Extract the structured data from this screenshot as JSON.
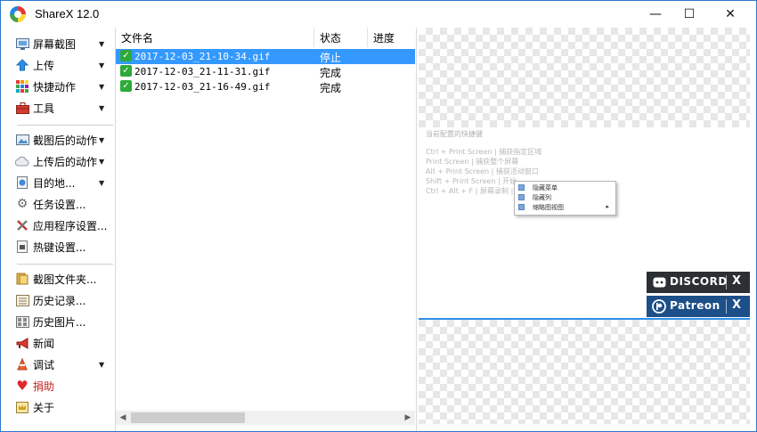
{
  "window": {
    "title": "ShareX 12.0",
    "minimize_glyph": "—",
    "maximize_glyph": "☐",
    "close_glyph": "✕"
  },
  "sidebar": {
    "items": [
      {
        "label": "屏幕截图",
        "icon": "screenshot-icon",
        "submenu": true
      },
      {
        "label": "上传",
        "icon": "upload-arrow-icon",
        "submenu": true
      },
      {
        "label": "快捷动作",
        "icon": "grid-icon",
        "submenu": true
      },
      {
        "label": "工具",
        "icon": "toolbox-icon",
        "submenu": true
      },
      {
        "label": "截图后的动作",
        "icon": "picture-icon",
        "submenu": true
      },
      {
        "label": "上传后的动作",
        "icon": "cloud-icon",
        "submenu": true
      },
      {
        "label": "目的地...",
        "icon": "globe-icon",
        "submenu": true
      },
      {
        "label": "任务设置...",
        "icon": "gear-icon",
        "submenu": false
      },
      {
        "label": "应用程序设置...",
        "icon": "wrench-icon",
        "submenu": false
      },
      {
        "label": "热键设置...",
        "icon": "keyboard-icon",
        "submenu": false
      },
      {
        "label": "截图文件夹...",
        "icon": "folder-icon",
        "submenu": false
      },
      {
        "label": "历史记录...",
        "icon": "history-list-icon",
        "submenu": false
      },
      {
        "label": "历史图片...",
        "icon": "image-history-icon",
        "submenu": false
      },
      {
        "label": "新闻",
        "icon": "megaphone-icon",
        "submenu": false
      },
      {
        "label": "调试",
        "icon": "traffic-cone-icon",
        "submenu": true
      },
      {
        "label": "捐助",
        "icon": "heart-icon",
        "submenu": false
      },
      {
        "label": "关于",
        "icon": "crown-icon",
        "submenu": false
      }
    ],
    "submenu_arrow": "▼"
  },
  "filelist": {
    "columns": [
      "文件名",
      "状态",
      "进度"
    ],
    "rows": [
      {
        "name": "2017-12-03_21-10-34.gif",
        "status": "停止",
        "selected": true
      },
      {
        "name": "2017-12-03_21-11-31.gif",
        "status": "完成",
        "selected": false
      },
      {
        "name": "2017-12-03_21-16-49.gif",
        "status": "完成",
        "selected": false
      }
    ],
    "check_glyph": "✓",
    "scroll_left": "◀",
    "scroll_right": "▶"
  },
  "preview": {
    "hotkey_title": "当前配置的快捷键",
    "hotkeys": [
      "Ctrl + Print Screen  |  捕获指定区域",
      "Print Screen  |  捕获整个屏幕",
      "Alt + Print Screen  |  捕获活动窗口",
      "Shift + Print Screen  |  开始",
      "Ctrl + Alt + F  |  屏幕录制  |"
    ],
    "context_menu": [
      {
        "label": "隐藏菜单",
        "arrow": ""
      },
      {
        "label": "隐藏列",
        "arrow": ""
      },
      {
        "label": "缩略图视图",
        "arrow": "▸"
      }
    ],
    "discord": {
      "label": "DISCORD",
      "close": "X",
      "color": "#2c2f33"
    },
    "patreon": {
      "label": "Patreon",
      "close": "X",
      "color": "#1d4f88"
    }
  },
  "colors": {
    "selection": "#3399ff",
    "window_border": "#2b78d0",
    "check_green": "#2eaa3a"
  }
}
